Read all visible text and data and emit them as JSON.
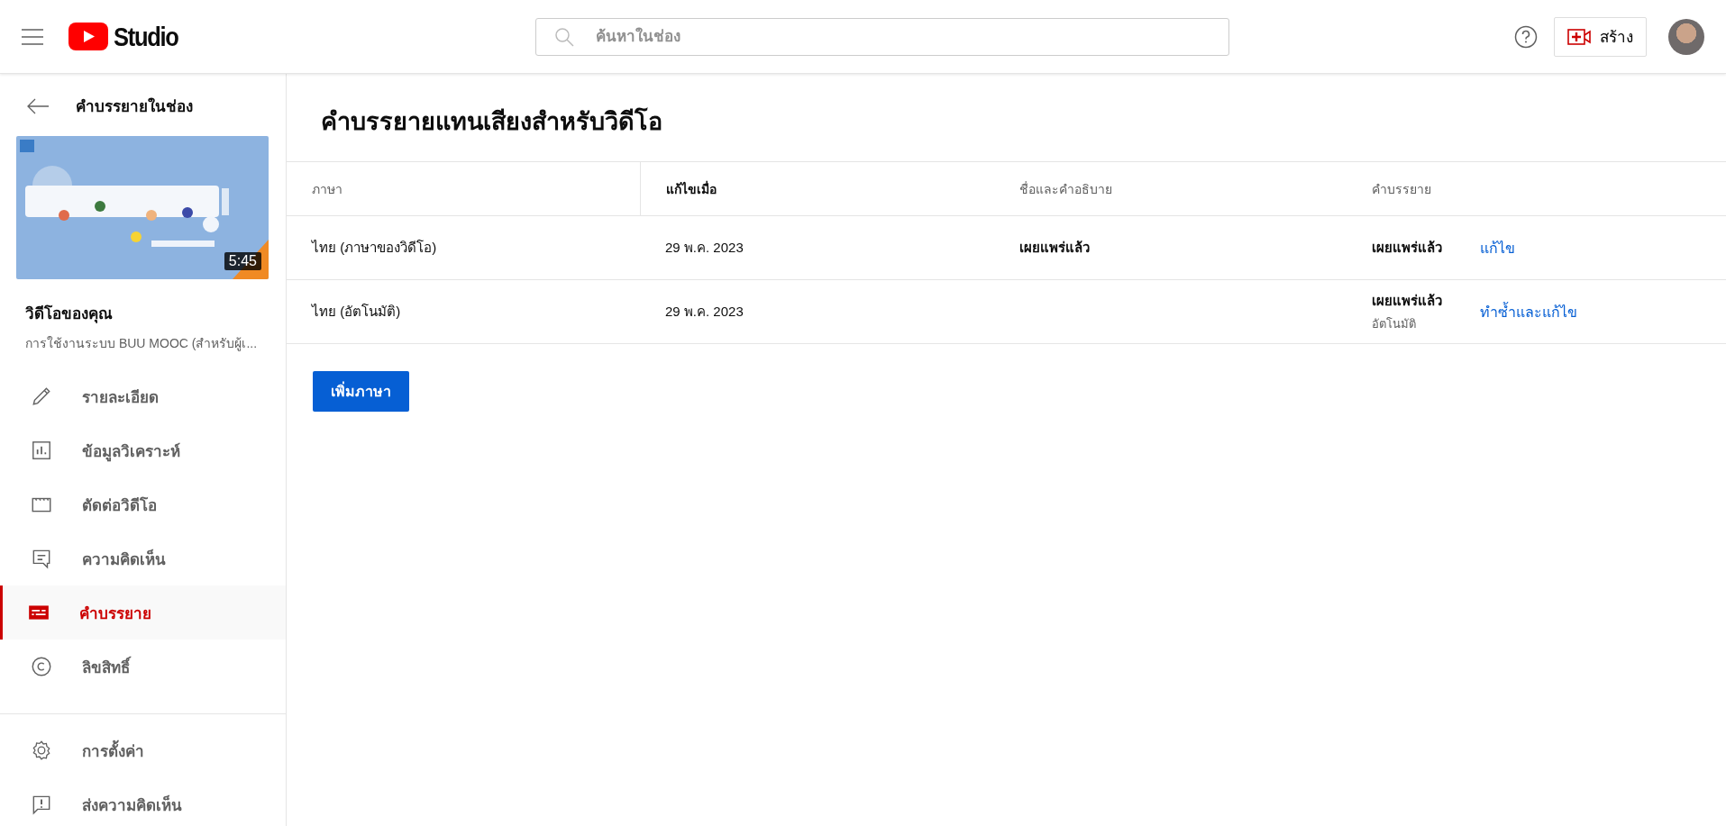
{
  "header": {
    "logo_text": "Studio",
    "search": {
      "placeholder": "ค้นหาในช่อง"
    },
    "create_button": "สร้าง"
  },
  "sidebar": {
    "back_title": "คำบรรยายในช่อง",
    "video": {
      "duration": "5:45",
      "label": "วิดีโอของคุณ",
      "title": "การใช้งานระบบ BUU MOOC (สำหรับผู้เ..."
    },
    "items": [
      {
        "label": "รายละเอียด",
        "selected": false
      },
      {
        "label": "ข้อมูลวิเคราะห์",
        "selected": false
      },
      {
        "label": "ตัดต่อวิดีโอ",
        "selected": false
      },
      {
        "label": "ความคิดเห็น",
        "selected": false
      },
      {
        "label": "คำบรรยาย",
        "selected": true
      },
      {
        "label": "ลิขสิทธิ์",
        "selected": false
      }
    ],
    "bottom_items": [
      {
        "label": "การตั้งค่า"
      },
      {
        "label": "ส่งความคิดเห็น"
      }
    ]
  },
  "page_title": "คำบรรยายแทนเสียงสำหรับวิดีโอ",
  "table": {
    "columns": [
      {
        "label": "ภาษา",
        "sorted": false
      },
      {
        "label": "แก้ไขเมื่อ",
        "sorted": true
      },
      {
        "label": "ชื่อและคำอธิบาย",
        "sorted": false
      },
      {
        "label": "คำบรรยาย",
        "sorted": false
      }
    ],
    "rows": [
      {
        "language": "ไทย (ภาษาของวิดีโอ)",
        "modified": "29 พ.ค. 2023",
        "title_description": "เผยแพร่แล้ว",
        "subtitles": "เผยแพร่แล้ว",
        "action": "แก้ไข"
      },
      {
        "language": "ไทย (อัตโนมัติ)",
        "modified": "29 พ.ค. 2023",
        "subtitles": "เผยแพร่แล้ว",
        "subtitles_note": "อัตโนมัติ",
        "action": "ทำซ้ำและแก้ไข"
      }
    ]
  },
  "add_language_button": "เพิ่มภาษา"
}
